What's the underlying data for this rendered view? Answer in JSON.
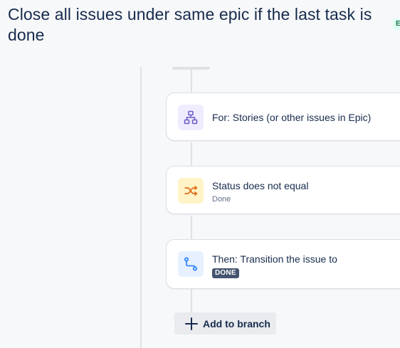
{
  "header": {
    "title": "Close all issues under same epic if the last task is done",
    "status_badge": "E"
  },
  "branch": {
    "steps": [
      {
        "title": "For: Stories (or other issues in Epic)",
        "icon": "hierarchy-icon",
        "icon_bg": "#efecff",
        "icon_color": "#6e5dc6"
      },
      {
        "title": "Status does not equal",
        "subtitle": "Done",
        "icon": "shuffle-condition-icon",
        "icon_bg": "#fff3c7",
        "icon_color": "#e0701b"
      },
      {
        "title": "Then: Transition the issue to",
        "lozenge": "DONE",
        "icon": "transition-path-icon",
        "icon_bg": "#e6f0ff",
        "icon_color": "#1d7afc"
      }
    ],
    "add_label": "Add to branch"
  },
  "colors": {
    "background": "#f7f8f9",
    "connector": "#dfe1e6",
    "text": "#172b4d",
    "subtle_text": "#626f86",
    "lozenge_bg": "#44546f"
  }
}
